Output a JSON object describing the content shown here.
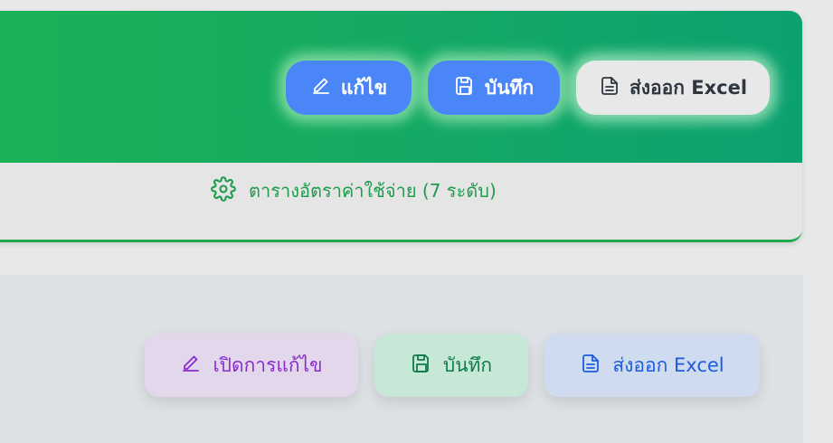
{
  "header": {
    "edit_label": "แก้ไข",
    "save_label": "บันทึก",
    "export_label": "ส่งออก Excel"
  },
  "settings": {
    "label": "ตารางอัตราค่าใช้จ่าย (7 ระดับ)"
  },
  "actions": {
    "open_edit_label": "เปิดการแก้ไข",
    "save_label": "บันทึก",
    "export_label": "ส่งออก Excel"
  },
  "colors": {
    "header_green": "#13a866",
    "primary_blue": "#4a86f7",
    "accent_green": "#1f9c4d",
    "purple": "#8a2bd0",
    "export_blue": "#1d5be0"
  }
}
